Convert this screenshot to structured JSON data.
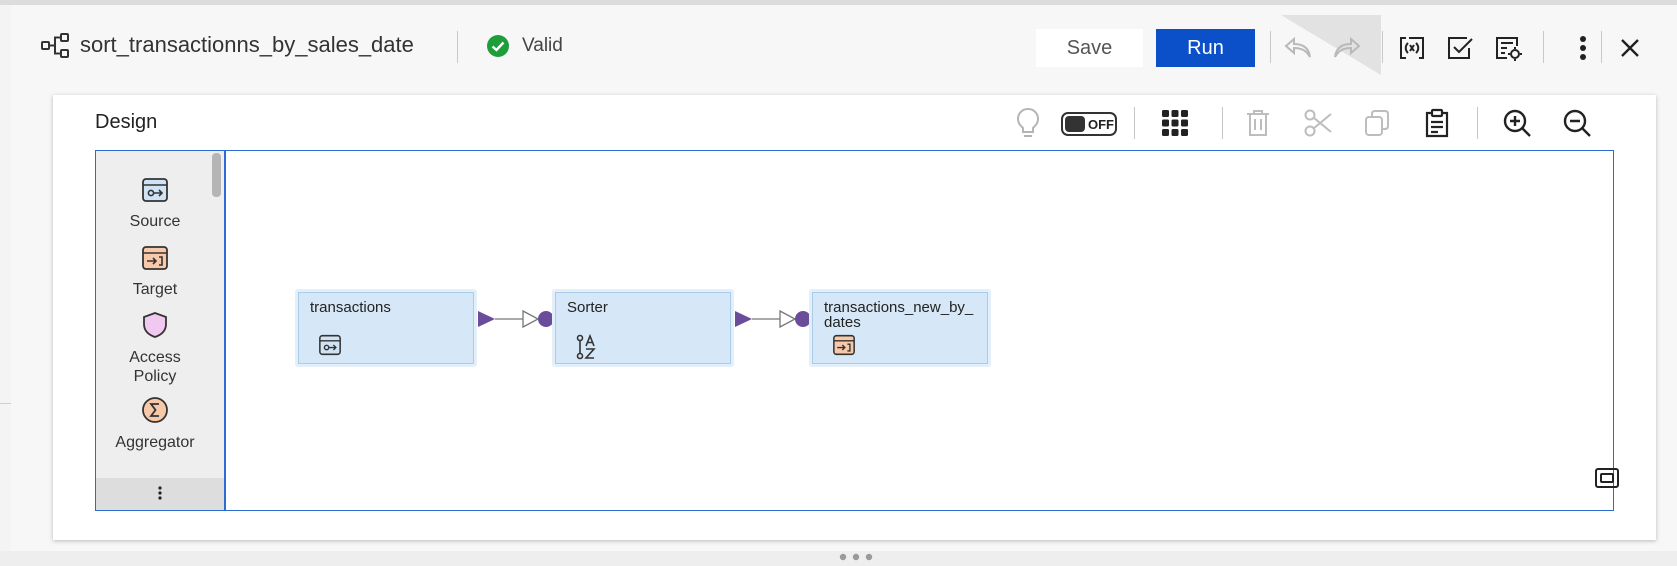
{
  "header": {
    "title": "sort_transactionns_by_sales_date",
    "status": "Valid",
    "save_label": "Save",
    "run_label": "Run",
    "toolbar_icons": [
      "undo-icon",
      "redo-icon",
      "parameters-icon",
      "validate-icon",
      "properties-icon",
      "more-vertical-icon",
      "close-icon"
    ]
  },
  "design": {
    "title": "Design",
    "toggle_label": "OFF",
    "toolbar_icons": [
      "lightbulb-icon",
      "arrange-grid-icon",
      "delete-icon",
      "cut-icon",
      "copy-icon",
      "paste-icon",
      "zoom-in-icon",
      "zoom-out-icon"
    ],
    "palette": [
      {
        "label": "Source",
        "icon": "source-icon"
      },
      {
        "label": "Target",
        "icon": "target-icon"
      },
      {
        "label": "Access\nPolicy",
        "icon": "access-policy-icon"
      },
      {
        "label": "Aggregator",
        "icon": "aggregator-icon"
      }
    ],
    "nodes": [
      {
        "label": "transactions",
        "icon": "source-icon"
      },
      {
        "label": "Sorter",
        "icon": "sorter-icon"
      },
      {
        "label": "transactions_new_by_\ndates",
        "icon": "target-icon"
      }
    ]
  },
  "colors": {
    "run_button": "#0b4fc9",
    "valid_green": "#1e9e3a",
    "node_fill": "#d6e8f8",
    "link_purple": "#6b4c9a",
    "canvas_border": "#2c6bd3"
  }
}
